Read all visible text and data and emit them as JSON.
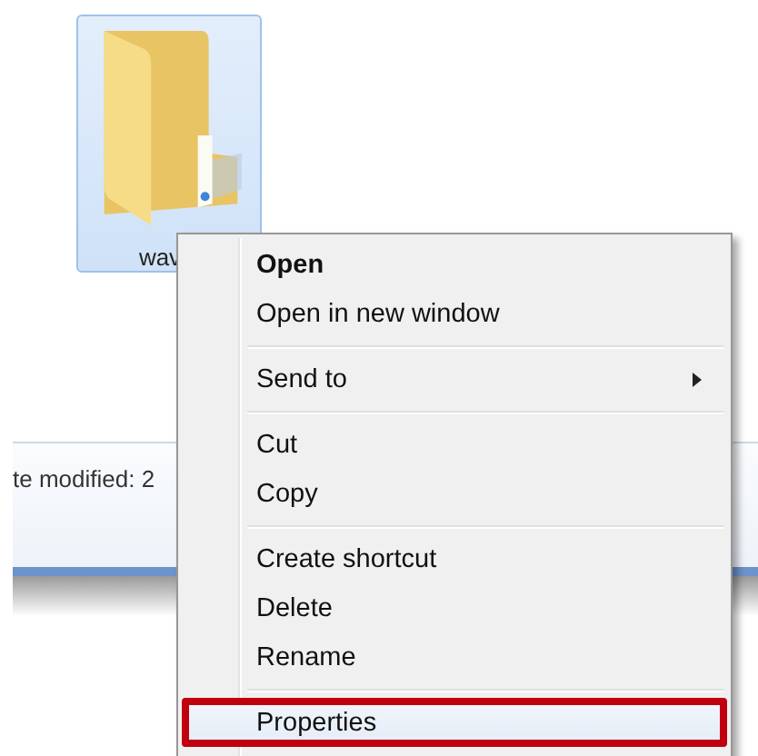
{
  "folder": {
    "name": "wav",
    "selected": true
  },
  "details_pane": {
    "text": "te modified: 2"
  },
  "context_menu": {
    "items": [
      {
        "kind": "item",
        "label": "Open",
        "default": true,
        "submenu": false,
        "highlighted": false
      },
      {
        "kind": "item",
        "label": "Open in new window",
        "default": false,
        "submenu": false,
        "highlighted": false
      },
      {
        "kind": "separator"
      },
      {
        "kind": "item",
        "label": "Send to",
        "default": false,
        "submenu": true,
        "highlighted": false
      },
      {
        "kind": "separator"
      },
      {
        "kind": "item",
        "label": "Cut",
        "default": false,
        "submenu": false,
        "highlighted": false
      },
      {
        "kind": "item",
        "label": "Copy",
        "default": false,
        "submenu": false,
        "highlighted": false
      },
      {
        "kind": "separator"
      },
      {
        "kind": "item",
        "label": "Create shortcut",
        "default": false,
        "submenu": false,
        "highlighted": false
      },
      {
        "kind": "item",
        "label": "Delete",
        "default": false,
        "submenu": false,
        "highlighted": false
      },
      {
        "kind": "item",
        "label": "Rename",
        "default": false,
        "submenu": false,
        "highlighted": false
      },
      {
        "kind": "separator"
      },
      {
        "kind": "item",
        "label": "Properties",
        "default": false,
        "submenu": false,
        "highlighted": true
      }
    ]
  }
}
